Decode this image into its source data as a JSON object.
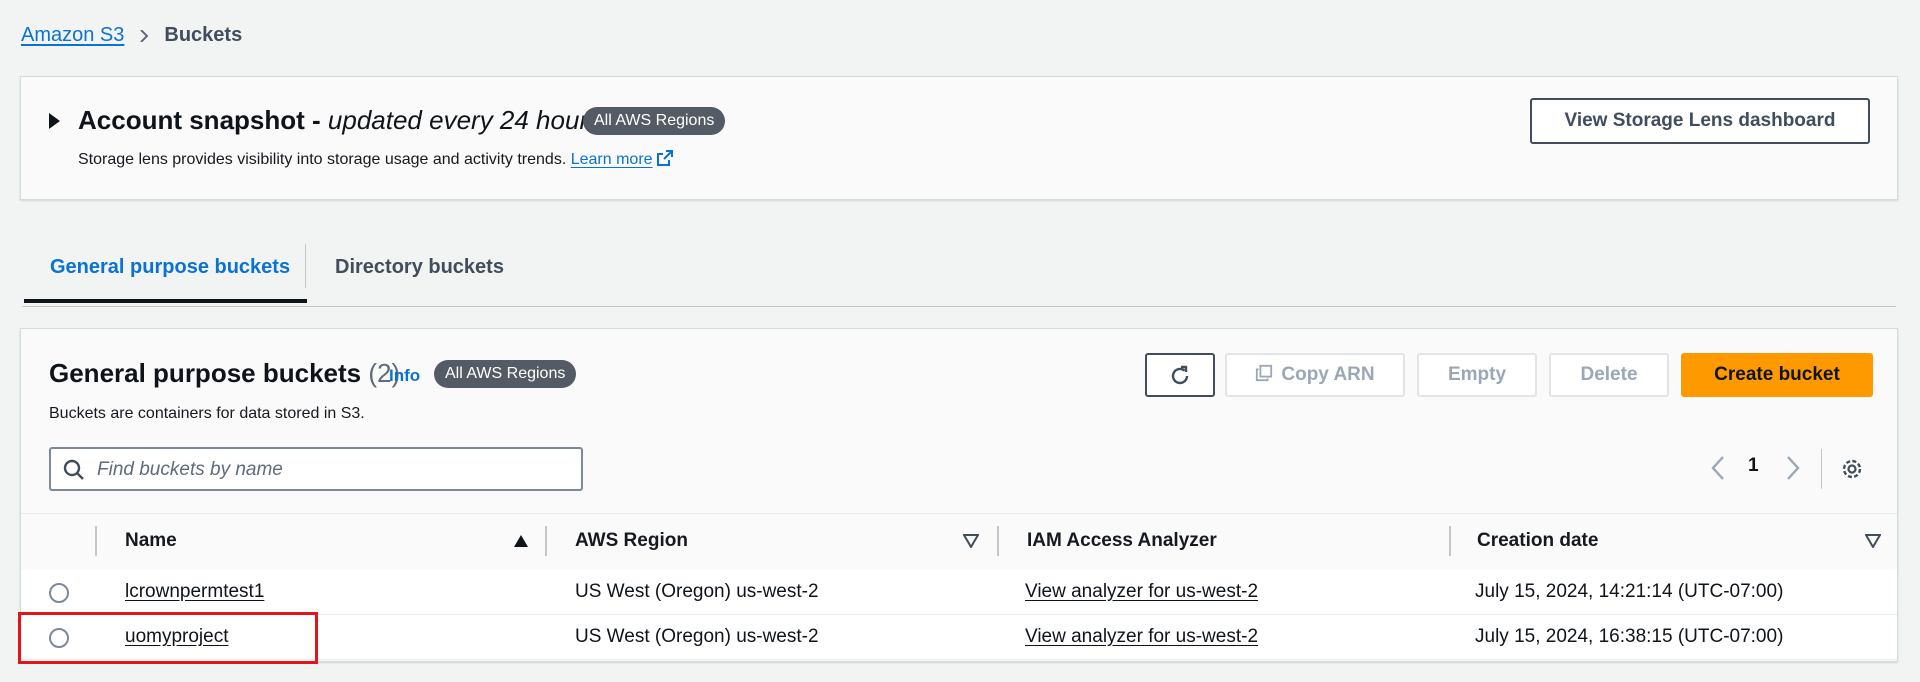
{
  "breadcrumb": {
    "root": "Amazon S3",
    "current": "Buckets"
  },
  "snapshot": {
    "title": "Account snapshot - ",
    "title_italic": "updated every 24 hours",
    "badge": "All AWS Regions",
    "description": "Storage lens provides visibility into storage usage and activity trends.",
    "learn_more": "Learn more",
    "lens_button": "View Storage Lens dashboard"
  },
  "tabs": [
    {
      "label": "General purpose buckets",
      "active": true
    },
    {
      "label": "Directory buckets",
      "active": false
    }
  ],
  "buckets_panel": {
    "title": "General purpose buckets",
    "count": "(2)",
    "info": "Info",
    "badge": "All AWS Regions",
    "description": "Buckets are containers for data stored in S3.",
    "actions": {
      "copy_arn": "Copy ARN",
      "empty": "Empty",
      "delete": "Delete",
      "create": "Create bucket"
    },
    "search_placeholder": "Find buckets by name",
    "page": "1"
  },
  "table": {
    "columns": [
      "Name",
      "AWS Region",
      "IAM Access Analyzer",
      "Creation date"
    ],
    "rows": [
      {
        "name": "lcrownpermtest1",
        "region": "US West (Oregon) us-west-2",
        "analyzer": "View analyzer for us-west-2",
        "created": "July 15, 2024, 14:21:14 (UTC-07:00)"
      },
      {
        "name": "uomyproject",
        "region": "US West (Oregon) us-west-2",
        "analyzer": "View analyzer for us-west-2",
        "created": "July 15, 2024, 16:38:15 (UTC-07:00)"
      }
    ]
  },
  "colors": {
    "link": "#0972d3",
    "primary_button": "#ff9900",
    "highlight": "#e0161b"
  }
}
